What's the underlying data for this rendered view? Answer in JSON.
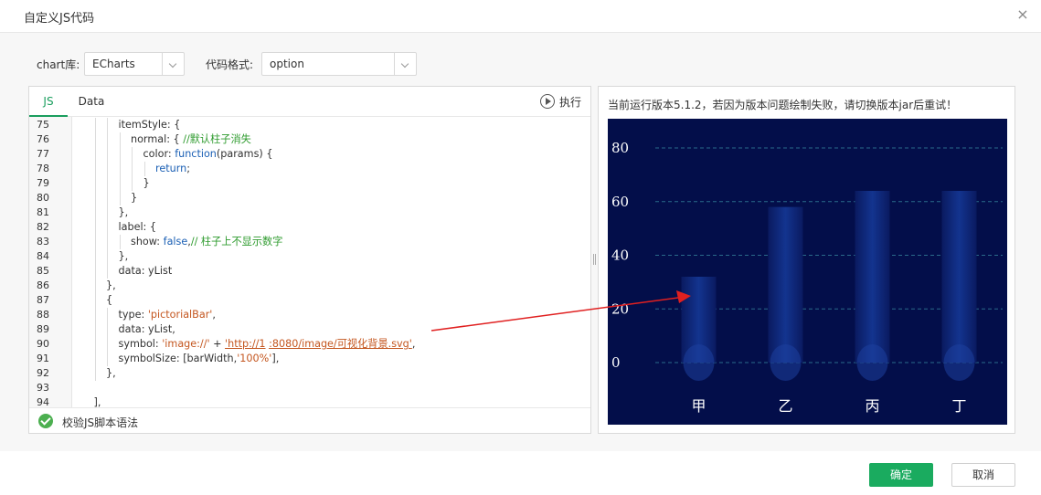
{
  "dialog": {
    "title": "自定义JS代码",
    "close_symbol": "×"
  },
  "toolbar": {
    "chart_lib_label": "chart库:",
    "chart_lib_value": "ECharts",
    "code_format_label": "代码格式:",
    "code_format_value": "option"
  },
  "editor": {
    "tabs": [
      {
        "label": "JS",
        "active": true
      },
      {
        "label": "Data",
        "active": false
      }
    ],
    "run_label": "执行",
    "validate_label": "校验JS脚本语法",
    "lines": [
      {
        "n": "75",
        "indent": 3,
        "parts": [
          [
            "df",
            "itemStyle: {"
          ]
        ]
      },
      {
        "n": "76",
        "indent": 4,
        "parts": [
          [
            "df",
            "normal: { "
          ],
          [
            "cm",
            "//默认柱子消失"
          ]
        ]
      },
      {
        "n": "77",
        "indent": 5,
        "parts": [
          [
            "df",
            "color: "
          ],
          [
            "kw",
            "function"
          ],
          [
            "df",
            "(params) {"
          ]
        ]
      },
      {
        "n": "78",
        "indent": 6,
        "parts": [
          [
            "kw",
            "return"
          ],
          [
            "df",
            ";"
          ]
        ]
      },
      {
        "n": "79",
        "indent": 5,
        "parts": [
          [
            "df",
            "}"
          ]
        ]
      },
      {
        "n": "80",
        "indent": 4,
        "parts": [
          [
            "df",
            "}"
          ]
        ]
      },
      {
        "n": "81",
        "indent": 3,
        "parts": [
          [
            "df",
            "},"
          ]
        ]
      },
      {
        "n": "82",
        "indent": 3,
        "parts": [
          [
            "df",
            "label: {"
          ]
        ]
      },
      {
        "n": "83",
        "indent": 4,
        "parts": [
          [
            "df",
            "show: "
          ],
          [
            "kw",
            "false"
          ],
          [
            "df",
            ","
          ],
          [
            "cm",
            "// 柱子上不显示数字"
          ]
        ]
      },
      {
        "n": "84",
        "indent": 3,
        "parts": [
          [
            "df",
            "},"
          ]
        ]
      },
      {
        "n": "85",
        "indent": 3,
        "parts": [
          [
            "df",
            "data: yList"
          ]
        ]
      },
      {
        "n": "86",
        "indent": 2,
        "parts": [
          [
            "df",
            "},"
          ]
        ]
      },
      {
        "n": "87",
        "indent": 2,
        "parts": [
          [
            "df",
            "{"
          ]
        ]
      },
      {
        "n": "88",
        "indent": 3,
        "parts": [
          [
            "df",
            "type: "
          ],
          [
            "st",
            "'pictorialBar'"
          ],
          [
            "df",
            ","
          ]
        ]
      },
      {
        "n": "89",
        "indent": 3,
        "parts": [
          [
            "df",
            "data: yList,"
          ]
        ]
      },
      {
        "n": "90",
        "indent": 3,
        "parts": [
          [
            "df",
            "symbol: "
          ],
          [
            "st",
            "'image://'"
          ],
          [
            "df",
            " + "
          ],
          [
            "st",
            "'http://1"
          ],
          [
            "st",
            "          "
          ],
          [
            "st",
            ":8080/image/可视化背景.svg'"
          ],
          [
            "df",
            ","
          ]
        ]
      },
      {
        "n": "91",
        "indent": 3,
        "parts": [
          [
            "df",
            "symbolSize: [barWidth,"
          ],
          [
            "st",
            "'100%'"
          ],
          [
            "df",
            "],"
          ]
        ]
      },
      {
        "n": "92",
        "indent": 2,
        "parts": [
          [
            "df",
            "},"
          ]
        ]
      },
      {
        "n": "93",
        "indent": 0,
        "parts": [
          [
            "df",
            ""
          ]
        ]
      },
      {
        "n": "94",
        "indent": 1,
        "parts": [
          [
            "df",
            "],"
          ]
        ]
      }
    ]
  },
  "preview": {
    "notice": "当前运行版本5.1.2，若因为版本问题绘制失败，请切换版本jar后重试！"
  },
  "chart_data": {
    "type": "bar",
    "categories": [
      "甲",
      "乙",
      "丙",
      "丁"
    ],
    "values": [
      32,
      58,
      64,
      64
    ],
    "ylim": [
      0,
      90
    ],
    "yticks": [
      "0",
      "20",
      "40",
      "60",
      "80"
    ],
    "grid": true,
    "colors": {
      "background": "#030e4a",
      "bar": "#0d2a8a",
      "grid": "#2a6a8a",
      "text": "#ffffff"
    }
  },
  "footer": {
    "ok_label": "确定",
    "cancel_label": "取消"
  },
  "annotation": {
    "color": "#e02020"
  }
}
